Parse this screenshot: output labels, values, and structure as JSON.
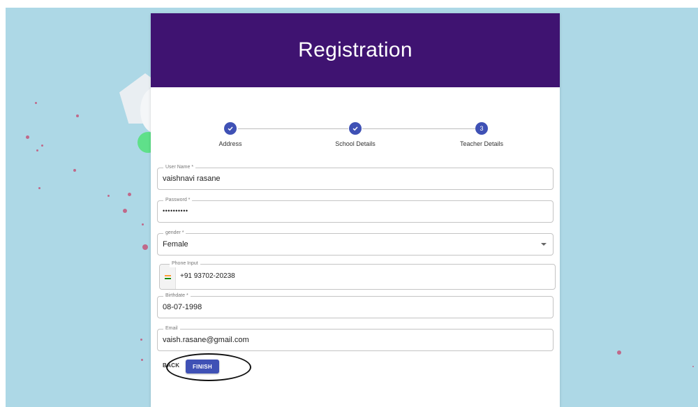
{
  "header": {
    "title": "Registration"
  },
  "stepper": {
    "steps": [
      {
        "label": "Address",
        "icon": "check-icon",
        "state": "completed"
      },
      {
        "label": "School Details",
        "icon": "check-icon",
        "state": "completed"
      },
      {
        "label": "Teacher Details",
        "number": "3",
        "state": "active"
      }
    ]
  },
  "form": {
    "username": {
      "label": "User Name *",
      "value": "vaishnavi rasane"
    },
    "password": {
      "label": "Password *",
      "value": "••••••••••"
    },
    "gender": {
      "label": "gender *",
      "value": "Female"
    },
    "phone": {
      "label": "Phone Input",
      "value": "+91 93702-20238",
      "flag": "india-flag-icon"
    },
    "birthdate": {
      "label": "Birthdate *",
      "value": "08-07-1998"
    },
    "email": {
      "label": "Email",
      "value": "vaish.rasane@gmail.com"
    }
  },
  "actions": {
    "back_label": "BACK",
    "finish_label": "FINISH"
  },
  "colors": {
    "header": "#3f1371",
    "primary": "#3f51b5",
    "background": "#add8e6"
  }
}
